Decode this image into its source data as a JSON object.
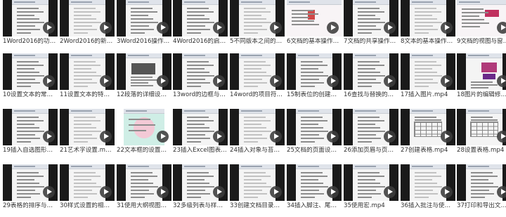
{
  "videos": [
    {
      "label": "1Word2016的功…"
    },
    {
      "label": "2Word2016的新…"
    },
    {
      "label": "3Word2016操作…"
    },
    {
      "label": "4Word2016的启…"
    },
    {
      "label": "5不同版本之间的…"
    },
    {
      "label": "6文档的基本操作…"
    },
    {
      "label": "7文档的共享操作…"
    },
    {
      "label": "8文本的基本操作…"
    },
    {
      "label": "9文档的视图与窗…"
    },
    {
      "label": "10设置文本的常…"
    },
    {
      "label": "11设置文本的特…"
    },
    {
      "label": "12段落的详细设…"
    },
    {
      "label": "13word的边框与…"
    },
    {
      "label": "14word的项目符…"
    },
    {
      "label": "15制表位的创建…"
    },
    {
      "label": "16查找与替换的…"
    },
    {
      "label": "17插入图片.mp4"
    },
    {
      "label": "18图片的编辑修…"
    },
    {
      "label": "19插入自选图形…"
    },
    {
      "label": "21艺术字设置.m…"
    },
    {
      "label": "22文本框的设置…"
    },
    {
      "label": "23插入Excel图表…"
    },
    {
      "label": "24插入对象与苔…"
    },
    {
      "label": "25文档的页面设…"
    },
    {
      "label": "26添加页眉与页…"
    },
    {
      "label": "27创建表格.mp4"
    },
    {
      "label": "28设置表格.mp4"
    },
    {
      "label": "29表格的排序与…"
    },
    {
      "label": "30样式设置的相…"
    },
    {
      "label": "31使用大纲视图…"
    },
    {
      "label": "32多级列表与样…"
    },
    {
      "label": "33创建文档目录…"
    },
    {
      "label": "34插入脚注、尾…"
    },
    {
      "label": "35使用宏.mp4"
    },
    {
      "label": "36插入批注与使…"
    },
    {
      "label": "37打印和导出文…"
    }
  ],
  "icons": {
    "play": "play-circle-icon"
  },
  "colors": {
    "background": "#ffffff",
    "thumb_frame": "#1a1a1a",
    "label_text": "#333333",
    "play_button": "#3c3c3c"
  }
}
